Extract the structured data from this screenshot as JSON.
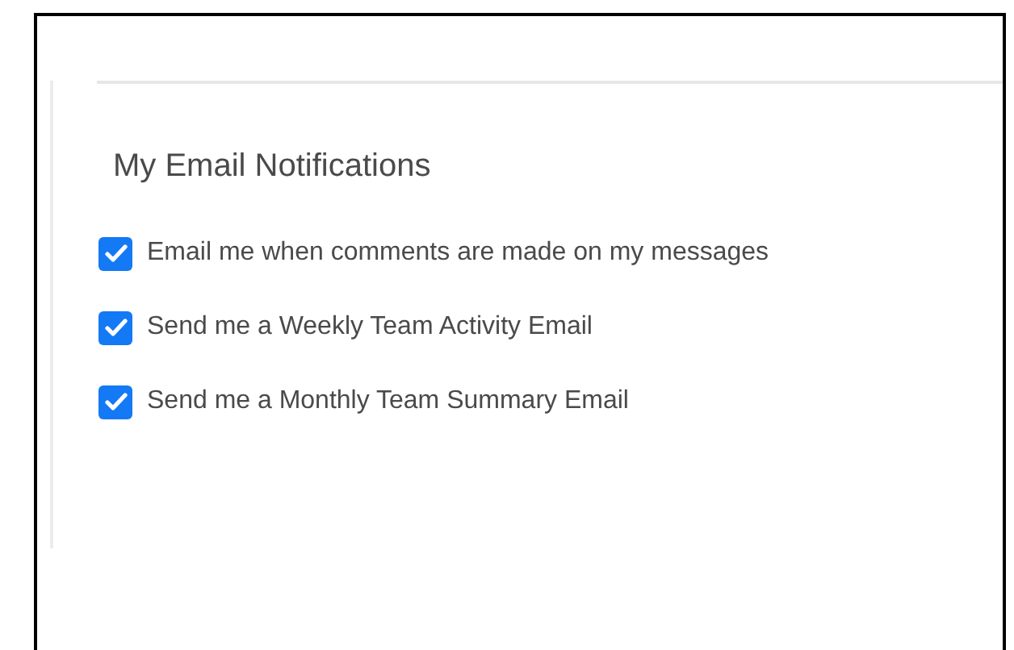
{
  "section": {
    "title": "My Email Notifications"
  },
  "options": [
    {
      "label": "Email me when comments are made on my messages",
      "checked": true
    },
    {
      "label": "Send me a Weekly Team Activity Email",
      "checked": true
    },
    {
      "label": "Send me a Monthly Team Summary Email",
      "checked": true
    }
  ]
}
